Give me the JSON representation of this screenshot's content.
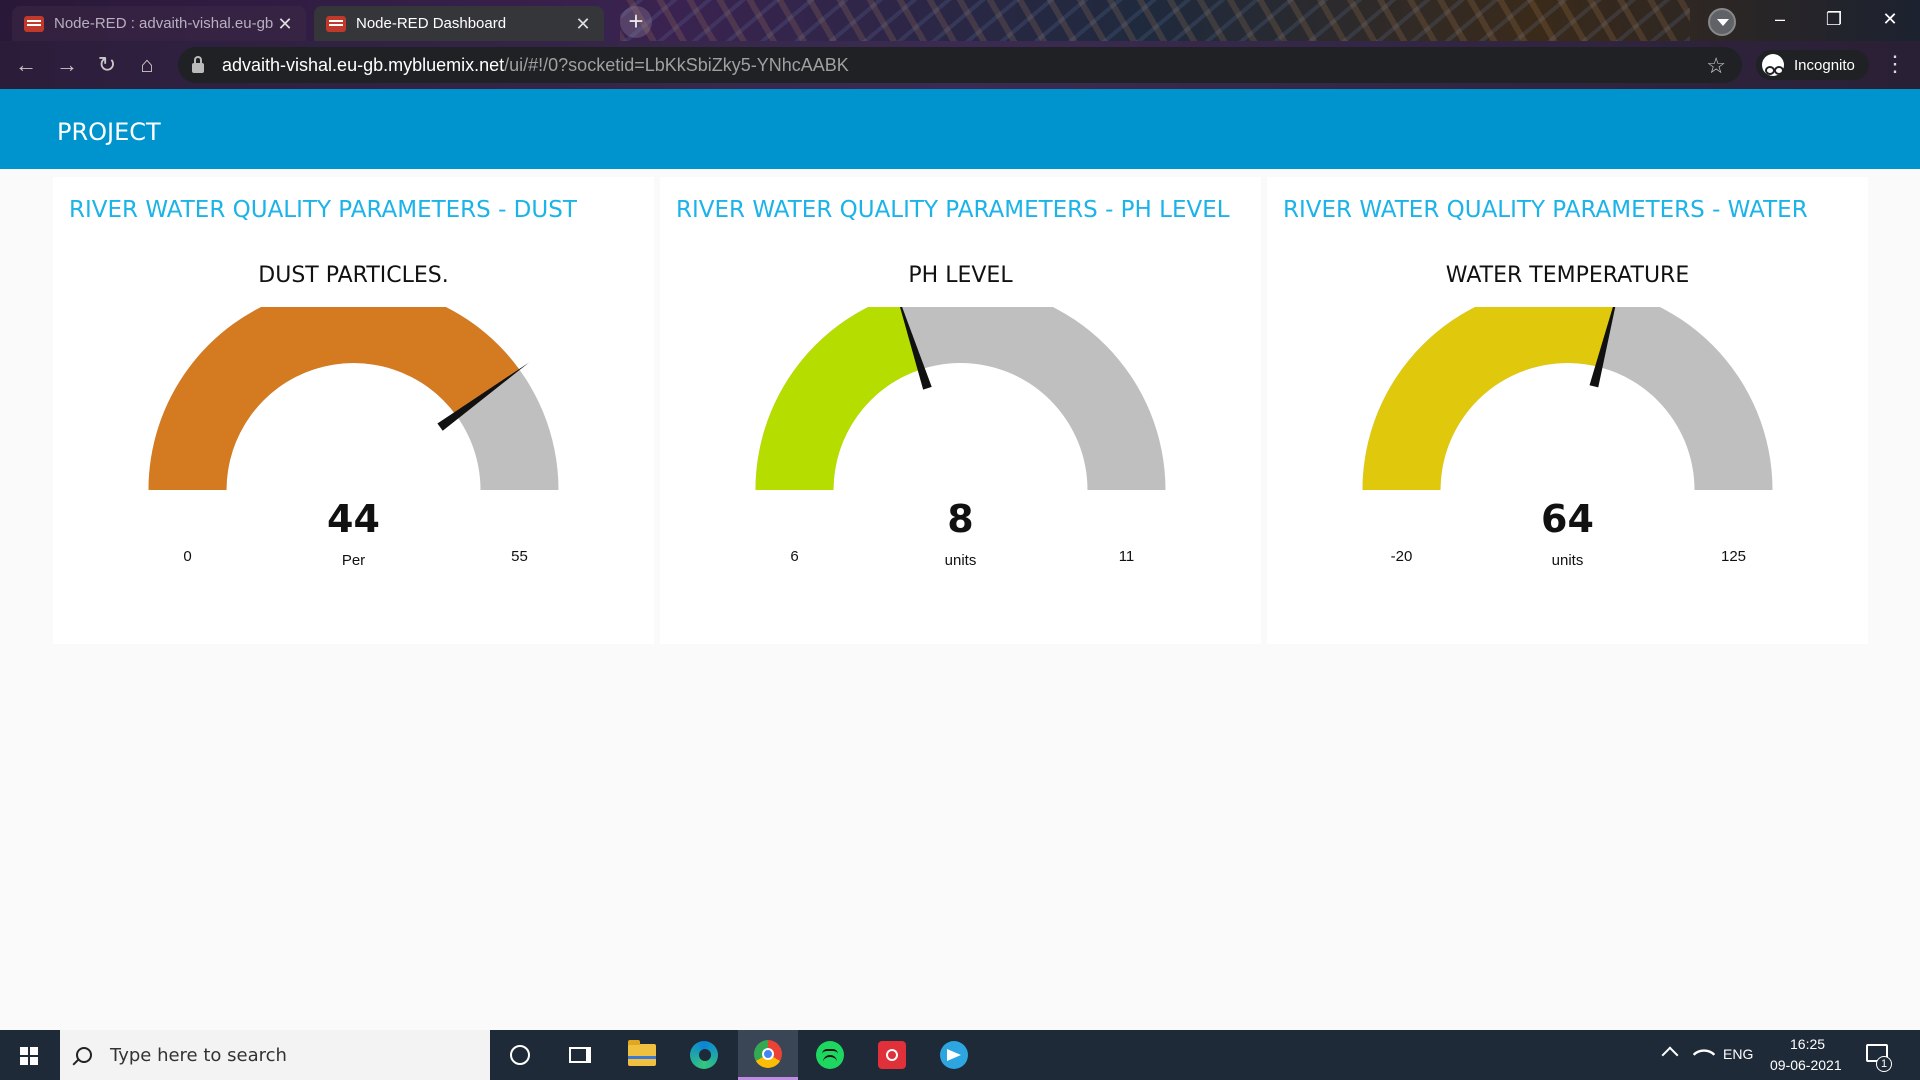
{
  "browser": {
    "tabs": [
      {
        "title": "Node-RED : advaith-vishal.eu-gb",
        "close": "✕",
        "active": false
      },
      {
        "title": "Node-RED Dashboard",
        "close": "✕",
        "active": true
      }
    ],
    "new_tab": "+",
    "url_host": "advaith-vishal.eu-gb.mybluemix.net",
    "url_path": "/ui/#!/0?socketid=LbKkSbiZky5-YNhcAABK",
    "incognito_label": "Incognito",
    "window_controls": {
      "minimize": "–",
      "restore": "❐",
      "close": "✕"
    }
  },
  "dashboard": {
    "title": "PROJECT",
    "gauges": [
      {
        "group_title": "RIVER WATER QUALITY PARAMETERS - DUST PARTICLES",
        "label": "DUST PARTICLES.",
        "value": "44",
        "units": "Per",
        "min": "0",
        "max": "55",
        "numeric": {
          "value": 44,
          "min": 0,
          "max": 55
        },
        "color": "#d47b22"
      },
      {
        "group_title": "RIVER WATER QUALITY PARAMETERS - PH LEVEL",
        "label": "PH LEVEL",
        "value": "8",
        "units": "units",
        "min": "6",
        "max": "11",
        "numeric": {
          "value": 8,
          "min": 6,
          "max": 11
        },
        "color": "#b5dd00"
      },
      {
        "group_title": "RIVER WATER QUALITY PARAMETERS - WATER TEMPERATURE",
        "label": "WATER TEMPERATURE",
        "value": "64",
        "units": "units",
        "min": "-20",
        "max": "125",
        "numeric": {
          "value": 64,
          "min": -20,
          "max": 125
        },
        "color": "#e0c80c"
      }
    ],
    "track_color": "#bfbfbf"
  },
  "taskbar": {
    "search_placeholder": "Type here to search",
    "language": "ENG",
    "time": "16:25",
    "date": "09-06-2021",
    "notification_count": "1"
  }
}
